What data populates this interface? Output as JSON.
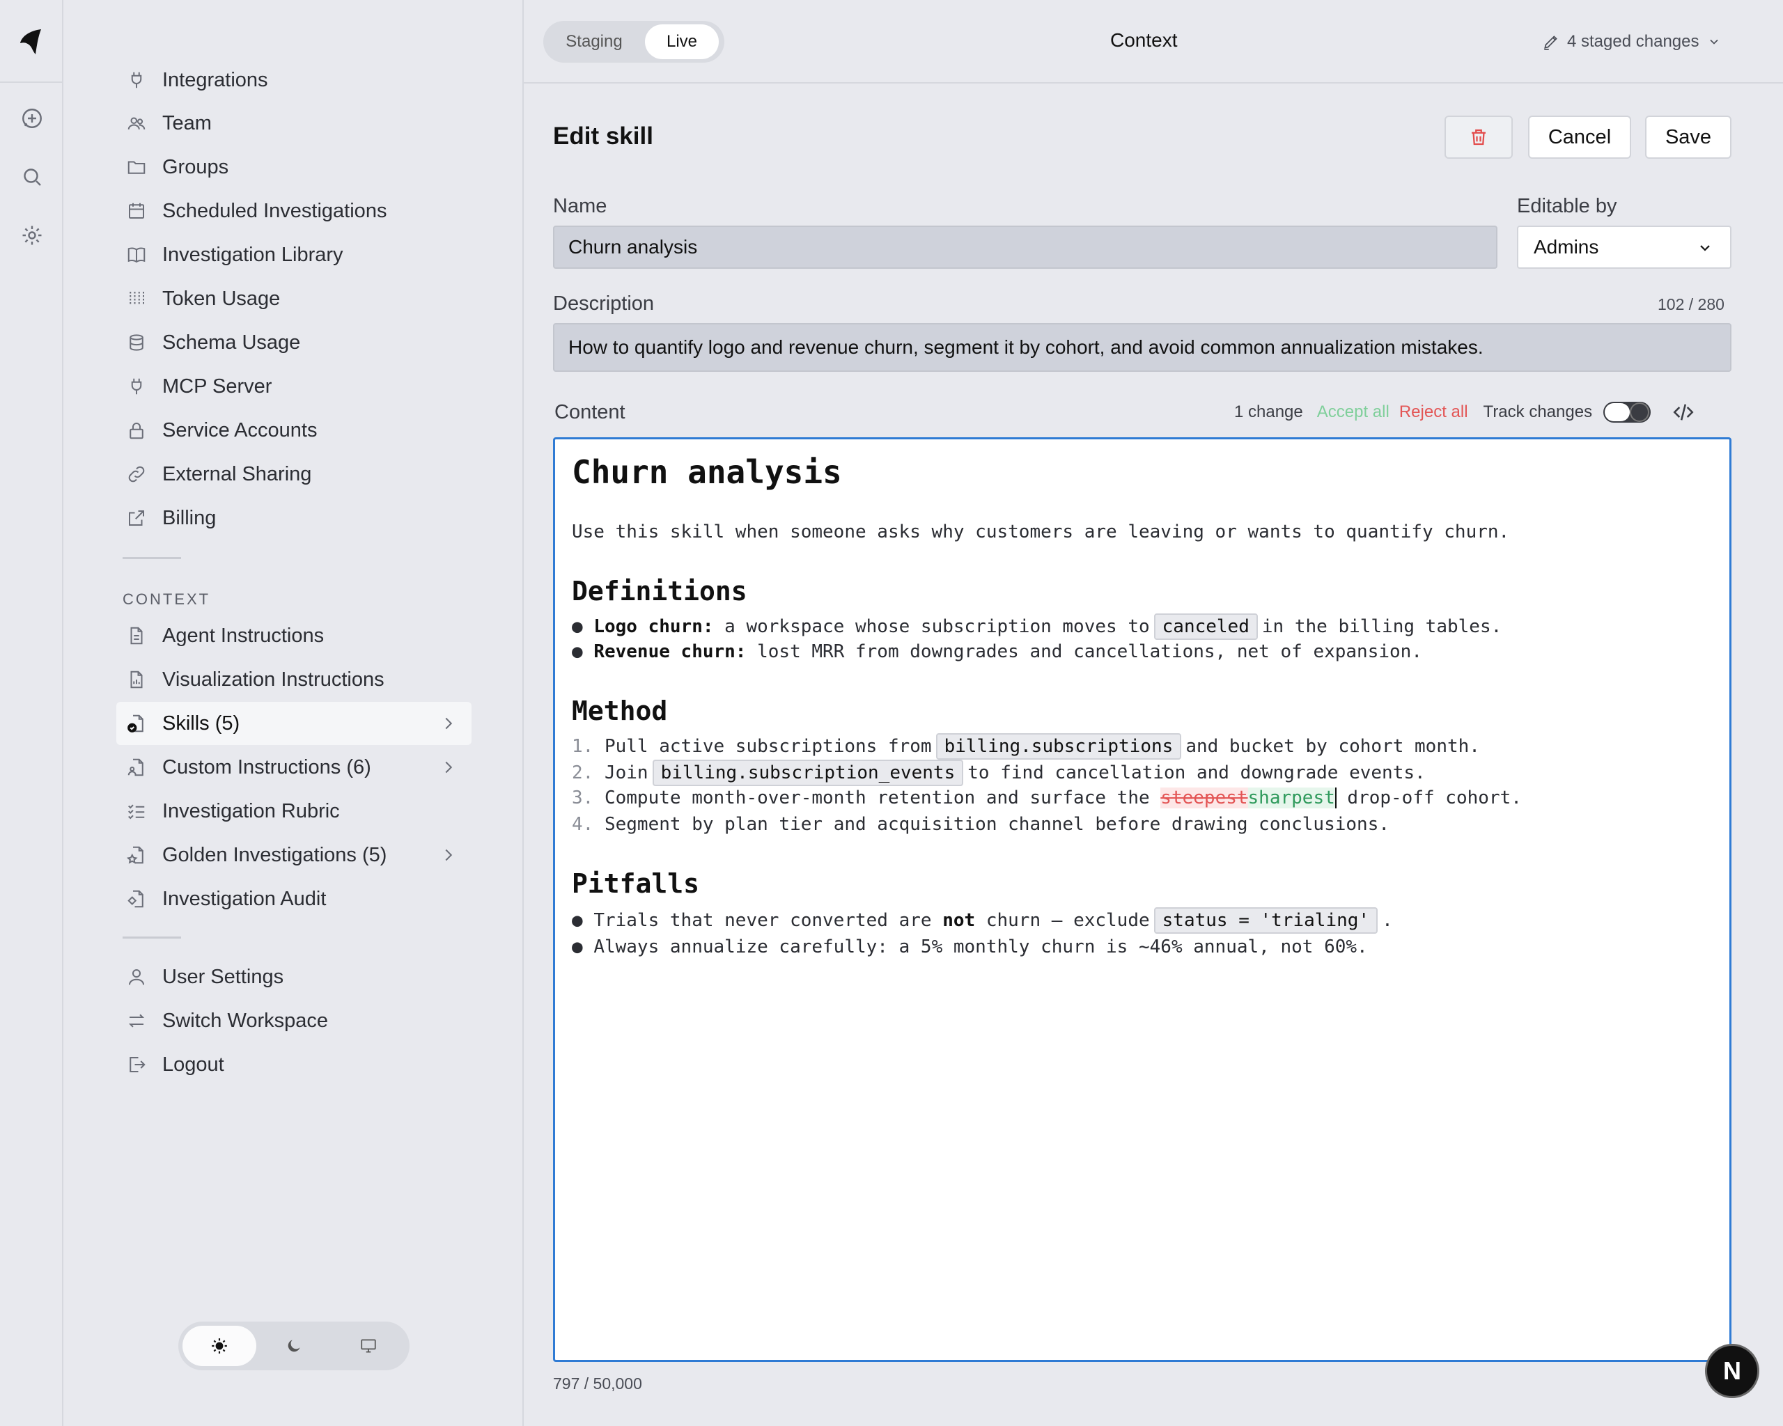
{
  "rail": {
    "icons": [
      "logo-icon",
      "new-chat-icon",
      "search-icon",
      "settings-icon"
    ]
  },
  "sidebar": {
    "items": [
      {
        "label": "Integrations",
        "icon": "plug-icon"
      },
      {
        "label": "Team",
        "icon": "team-icon"
      },
      {
        "label": "Groups",
        "icon": "folder-icon"
      },
      {
        "label": "Scheduled Investigations",
        "icon": "calendar-icon"
      },
      {
        "label": "Investigation Library",
        "icon": "book-icon"
      },
      {
        "label": "Token Usage",
        "icon": "usage-icon"
      },
      {
        "label": "Schema Usage",
        "icon": "database-icon"
      },
      {
        "label": "MCP Server",
        "icon": "plug-icon"
      },
      {
        "label": "Service Accounts",
        "icon": "lock-icon"
      },
      {
        "label": "External Sharing",
        "icon": "link-icon"
      },
      {
        "label": "Billing",
        "icon": "external-link-icon"
      }
    ],
    "context_label": "CONTEXT",
    "context_items": [
      {
        "label": "Agent Instructions",
        "icon": "file-icon"
      },
      {
        "label": "Visualization Instructions",
        "icon": "file-chart-icon"
      },
      {
        "label": "Skills (5)",
        "icon": "file-check-icon",
        "active": true
      },
      {
        "label": "Custom Instructions (6)",
        "icon": "file-user-icon"
      },
      {
        "label": "Investigation Rubric",
        "icon": "checklist-icon"
      },
      {
        "label": "Golden Investigations (5)",
        "icon": "file-star-icon"
      },
      {
        "label": "Investigation Audit",
        "icon": "file-audit-icon"
      }
    ],
    "bottom_items": [
      {
        "label": "User Settings",
        "icon": "user-icon"
      },
      {
        "label": "Switch Workspace",
        "icon": "switch-icon"
      },
      {
        "label": "Logout",
        "icon": "logout-icon"
      }
    ],
    "theme": {
      "selected": "light"
    }
  },
  "topbar": {
    "env": {
      "staging": "Staging",
      "live": "Live",
      "selected": "Live"
    },
    "title": "Context",
    "staged_changes": "4 staged changes"
  },
  "edit": {
    "heading": "Edit skill",
    "cancel": "Cancel",
    "save": "Save",
    "name_label": "Name",
    "name_value": "Churn analysis",
    "editable_label": "Editable by",
    "editable_value": "Admins",
    "description_label": "Description",
    "description_count": "102 / 280",
    "description_value": "How to quantify logo and revenue churn, segment it by cohort, and avoid common annualization mistakes.",
    "content_label": "Content",
    "change_count": "1 change",
    "accept_all": "Accept all",
    "reject_all": "Reject all",
    "track_changes": "Track changes",
    "track_on": true,
    "content_count": "797 / 50,000"
  },
  "doc": {
    "h1": "Churn analysis",
    "intro": "Use this skill when someone asks why customers are leaving or wants to quantify churn.",
    "h_definitions": "Definitions",
    "def1_bold": "Logo churn:",
    "def1_pre": " a workspace whose subscription moves to",
    "def1_code": "canceled",
    "def1_post": "in the billing tables.",
    "def2_bold": "Revenue churn:",
    "def2_text": " lost MRR from downgrades and cancellations, net of expansion.",
    "h_method": "Method",
    "m1_num": "1.",
    "m1_pre": "Pull active subscriptions from",
    "m1_code": "billing.subscriptions",
    "m1_post": "and bucket by cohort month.",
    "m2_num": "2.",
    "m2_pre": "Join",
    "m2_code": "billing.subscription_events",
    "m2_post": "to find cancellation and downgrade events.",
    "m3_num": "3.",
    "m3_pre": "Compute month-over-month retention and surface the ",
    "m3_del": "steepest",
    "m3_ins": "sharpest",
    "m3_post": " drop-off cohort.",
    "m4_num": "4.",
    "m4_text": "Segment by plan tier and acquisition channel before drawing conclusions.",
    "h_pitfalls": "Pitfalls",
    "p1_pre": "Trials that never converted are ",
    "p1_bold": "not",
    "p1_mid": " churn — exclude",
    "p1_code": "status = 'trialing'",
    "p1_post": ".",
    "p2_text": "Always annualize carefully: a 5% monthly churn is ~46% annual, not 60%."
  },
  "fab_label": "N"
}
